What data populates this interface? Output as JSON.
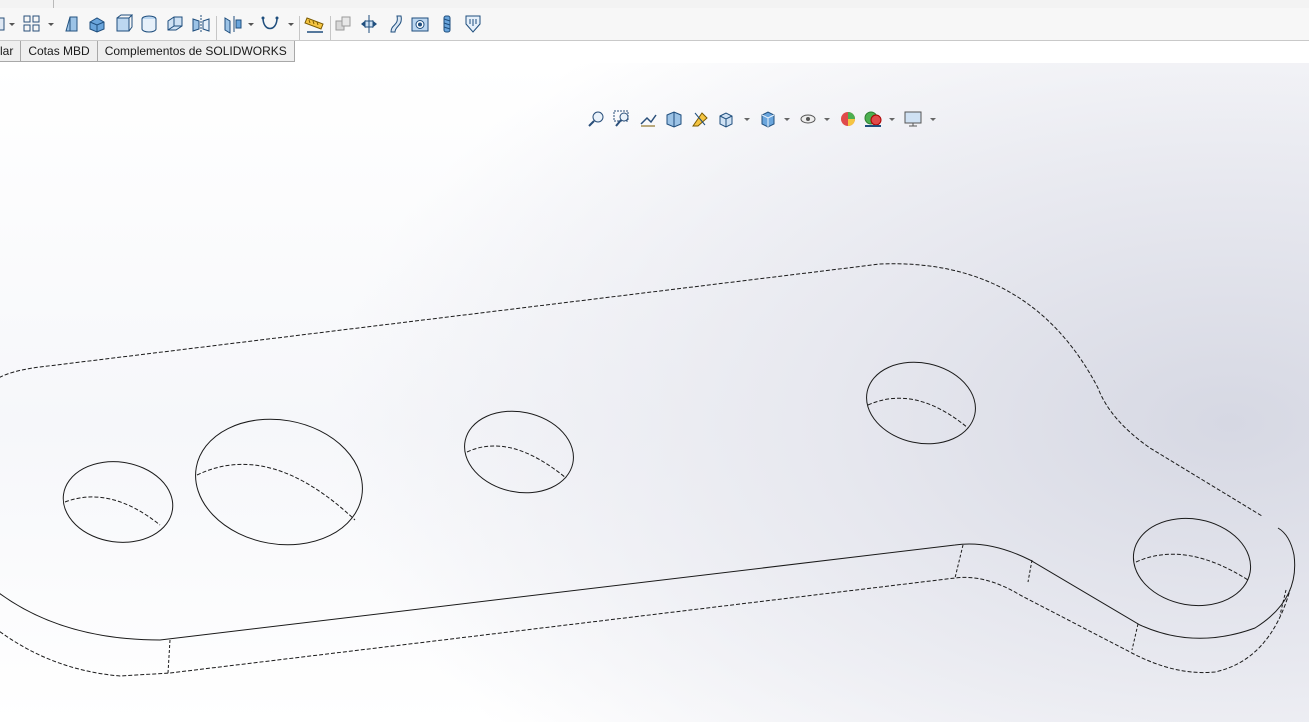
{
  "tabs": [
    {
      "label": "lar"
    },
    {
      "label": "Cotas MBD"
    },
    {
      "label": "Complementos de SOLIDWORKS"
    }
  ],
  "toolbar_icons": [
    "partial-icon",
    "dropdown-arrow-icon",
    "pattern-icon",
    "dropdown-arrow-icon",
    "sheet-metal-icon",
    "extrude-boss-icon",
    "box-icon",
    "cylinder-icon",
    "section-icon",
    "mirror-icon",
    "reference-plane-icon",
    "dropdown-arrow-icon",
    "curves-icon",
    "dropdown-arrow-icon",
    "measure-icon",
    "assembly-icon",
    "move-icon",
    "flex-icon",
    "hole-wizard-icon",
    "thread-icon",
    "shield-icon"
  ],
  "headsup_icons": [
    "zoom-to-fit-icon",
    "zoom-to-area-icon",
    "previous-view-icon",
    "section-view-icon",
    "dynamic-annotation-icon",
    "view-orientation-icon",
    "display-style-icon",
    "hide-show-items-icon",
    "edit-appearance-icon",
    "apply-scene-icon",
    "view-settings-icon"
  ],
  "colors": {
    "toolbar_bg": "#f7f7f7",
    "icon_blue": "#2a6fb0",
    "viewport_shade": "#d6d8e3",
    "edge": "#1a1a1a"
  }
}
